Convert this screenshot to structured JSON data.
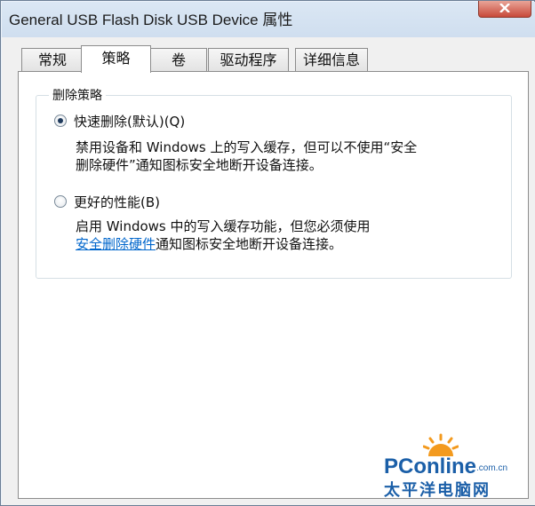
{
  "window": {
    "title": "General USB Flash Disk USB Device 属性"
  },
  "tabs": [
    {
      "label": "常规"
    },
    {
      "label": "策略"
    },
    {
      "label": "卷"
    },
    {
      "label": "驱动程序"
    },
    {
      "label": "详细信息"
    }
  ],
  "active_tab": "策略",
  "removal_policy": {
    "group_title": "删除策略",
    "quick_removal": {
      "label": "快速删除(默认)(Q)",
      "selected": true,
      "desc_line1": "禁用设备和 Windows 上的写入缓存，但可以不使用“安全",
      "desc_line2": "删除硬件”通知图标安全地断开设备连接。"
    },
    "better_performance": {
      "label": "更好的性能(B)",
      "selected": false,
      "desc_line1": "启用 Windows 中的写入缓存功能，但您必须使用",
      "desc_link": "安全删除硬件",
      "desc_line2_rest": "通知图标安全地断开设备连接。"
    }
  },
  "watermark": {
    "brand": "PConline",
    "domain": ".com.cn",
    "chinese": "太平洋电脑网"
  },
  "colors": {
    "link": "#0066cc",
    "watermark": "#1b5fa8",
    "watermark_sun": "#f39a1e"
  },
  "icons": {
    "close": "close-icon",
    "radio_selected": "radio-selected-icon",
    "radio_empty": "radio-unselected-icon",
    "watermark_sun": "sun-logo-icon"
  }
}
